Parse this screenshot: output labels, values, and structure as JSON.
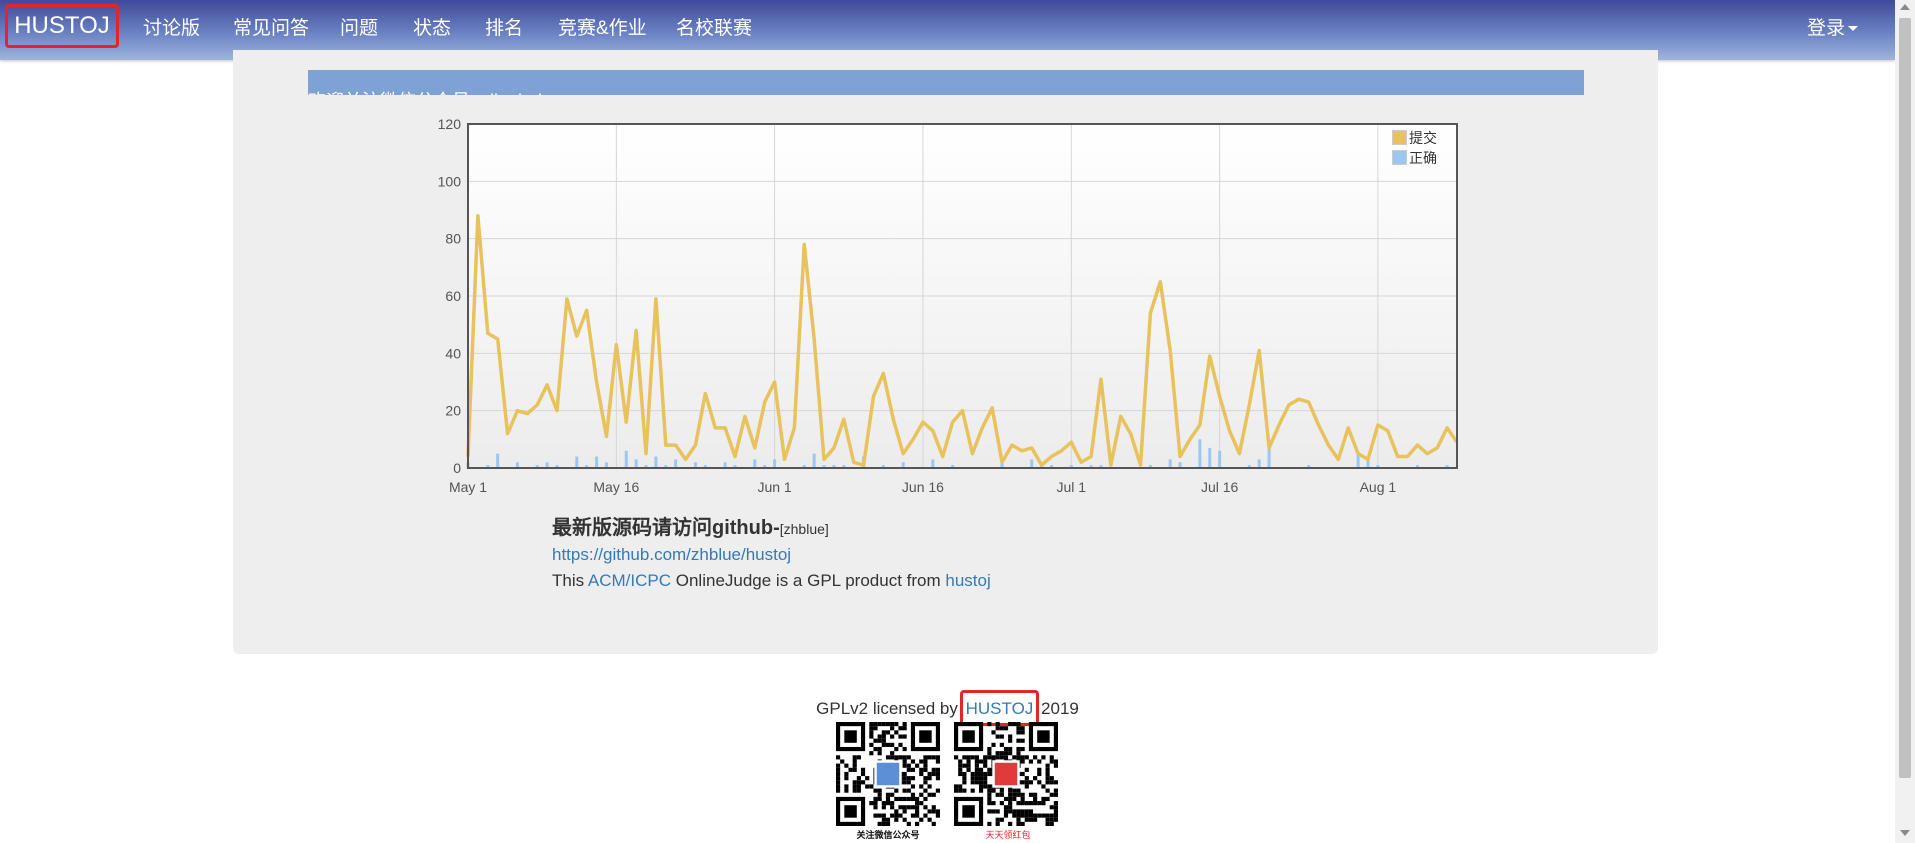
{
  "nav": {
    "brand": "HUSTOJ",
    "items": [
      "讨论版",
      "常见问答",
      "问题",
      "状态",
      "排名",
      "竞赛&作业",
      "名校联赛"
    ],
    "login": "登录"
  },
  "notice": "欢迎关注微信公众号onlinejudge",
  "chart_data": {
    "type": "line",
    "x_ticks": [
      "May 1",
      "May 16",
      "Jun 1",
      "Jun 16",
      "Jul 1",
      "Jul 16",
      "Aug 1"
    ],
    "ylim": [
      0,
      120
    ],
    "y_ticks": [
      0,
      20,
      40,
      60,
      80,
      100,
      120
    ],
    "grid": true,
    "legend_position": "top-right",
    "series": [
      {
        "name": "提交",
        "color": "#e8c25c",
        "style": "line",
        "values": [
          4,
          88,
          47,
          45,
          12,
          20,
          19,
          22,
          29,
          20,
          59,
          46,
          55,
          30,
          11,
          43,
          16,
          48,
          5,
          59,
          8,
          8,
          3,
          8,
          26,
          14,
          14,
          4,
          18,
          7,
          23,
          30,
          3,
          14,
          78,
          45,
          3,
          7,
          17,
          2,
          1,
          25,
          33,
          17,
          5,
          10,
          16,
          13,
          4,
          16,
          20,
          5,
          14,
          21,
          2,
          8,
          6,
          7,
          1,
          4,
          6,
          9,
          2,
          4,
          31,
          1,
          18,
          12,
          1,
          54,
          65,
          41,
          4,
          10,
          15,
          39,
          25,
          13,
          5,
          22,
          41,
          7,
          15,
          22,
          24,
          23,
          15,
          8,
          3,
          14,
          5,
          3,
          15,
          13,
          4,
          4,
          8,
          5,
          7,
          14,
          9
        ]
      },
      {
        "name": "正确",
        "color": "#9cc8f0",
        "style": "bar",
        "values": [
          2,
          0,
          1,
          5,
          0,
          2,
          0,
          1,
          2,
          1,
          0,
          4,
          1,
          4,
          2,
          0,
          6,
          3,
          1,
          4,
          1,
          3,
          0,
          2,
          1,
          0,
          2,
          1,
          0,
          3,
          1,
          3,
          0,
          0,
          1,
          5,
          1,
          1,
          1,
          0,
          4,
          0,
          1,
          0,
          2,
          0,
          0,
          3,
          0,
          1,
          0,
          0,
          0,
          0,
          2,
          0,
          0,
          3,
          1,
          1,
          0,
          1,
          0,
          1,
          1,
          0,
          0,
          0,
          0,
          1,
          0,
          3,
          2,
          0,
          10,
          7,
          6,
          0,
          0,
          1,
          3,
          7,
          0,
          0,
          0,
          1,
          0,
          0,
          0,
          0,
          5,
          3,
          1,
          0,
          0,
          0,
          1,
          0,
          0,
          1,
          0
        ]
      }
    ]
  },
  "info": {
    "headline": "最新版源码请访问github-",
    "headline_small": "[zhblue]",
    "link": "https://github.com/zhblue/hustoj",
    "line3_prefix": "This ",
    "line3_link1": "ACM/ICPC",
    "line3_mid": " OnlineJudge is a GPL product from ",
    "line3_link2": "hustoj"
  },
  "footer": {
    "prefix": "GPLv2 licensed by ",
    "link": "HUSTOJ",
    "suffix": " 2019",
    "qr1_caption": "关注微信公众号",
    "qr2_caption": "天天领红包"
  }
}
